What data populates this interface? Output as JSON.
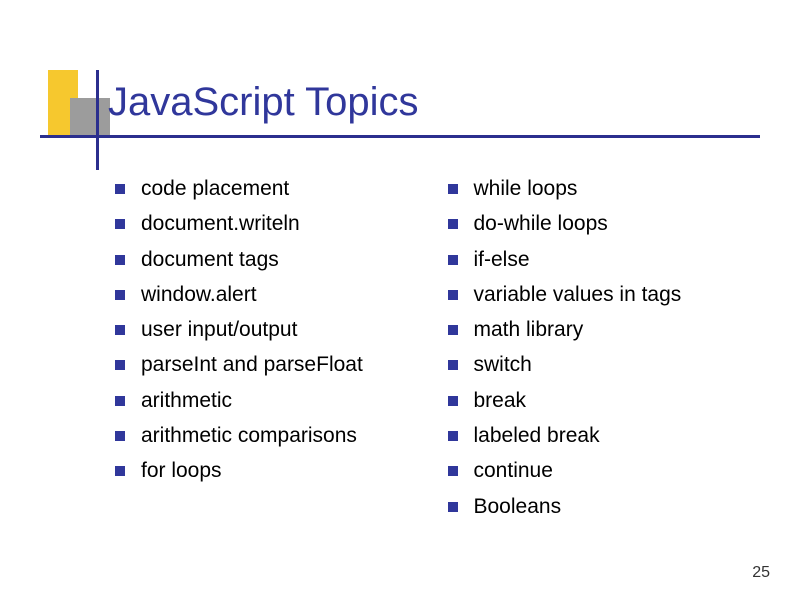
{
  "title": "JavaScript Topics",
  "pageNumber": "25",
  "leftColumn": [
    "code placement",
    "document.writeln",
    "document tags",
    "window.alert",
    "user input/output",
    "parseInt and parseFloat",
    "arithmetic",
    "arithmetic comparisons",
    "for loops"
  ],
  "rightColumn": [
    "while loops",
    "do-while loops",
    "if-else",
    "variable values in tags",
    "math library",
    "switch",
    "break",
    "labeled break",
    "continue",
    "Booleans"
  ]
}
